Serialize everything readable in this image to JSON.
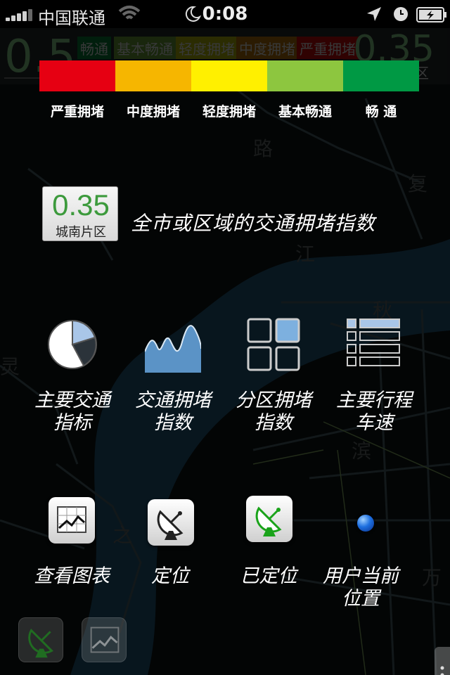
{
  "status_bar": {
    "carrier": "中国联通",
    "time": "0:08"
  },
  "under_header": {
    "left_index": "0.5",
    "right_index": "0.35",
    "chips": [
      "畅通",
      "基本畅通",
      "轻度拥堵",
      "中度拥堵",
      "严重拥堵"
    ],
    "zone_label": "区"
  },
  "legend": {
    "segments": [
      {
        "label": "严重拥堵",
        "color": "#e60012"
      },
      {
        "label": "中度拥堵",
        "color": "#f6b600"
      },
      {
        "label": "轻度拥堵",
        "color": "#fff000"
      },
      {
        "label": "基本畅通",
        "color": "#8dc63f"
      },
      {
        "label": "畅 通",
        "color": "#009944"
      }
    ]
  },
  "index_sample": {
    "value": "0.35",
    "zone": "城南片区",
    "hint": "全市或区域的交通拥堵指数"
  },
  "functions": [
    {
      "icon": "pie-chart-icon",
      "caption_1": "主要交通",
      "caption_2": "指标"
    },
    {
      "icon": "area-chart-icon",
      "caption_1": "交通拥堵",
      "caption_2": "指数"
    },
    {
      "icon": "grid-icon",
      "caption_1": "分区拥堵",
      "caption_2": "指数"
    },
    {
      "icon": "list-icon",
      "caption_1": "主要行程",
      "caption_2": "车速"
    }
  ],
  "tools": {
    "chart_caption": "查看图表",
    "locate_caption": "定位",
    "located_caption": "已定位",
    "user_pos_caption_1": "用户当前",
    "user_pos_caption_2": "位置"
  },
  "colors": {
    "tile_green": "#1aa31a",
    "pie_fill": "#a9c6e8",
    "area_fill": "#5b93c6",
    "grid_fill": "#7db0df"
  }
}
